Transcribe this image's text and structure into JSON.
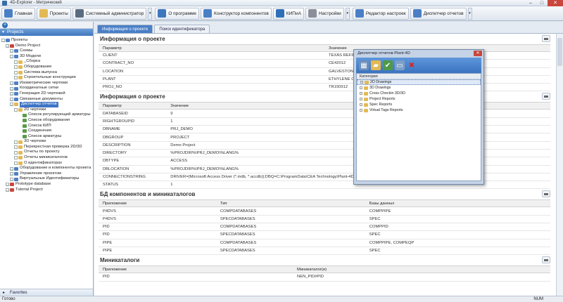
{
  "window": {
    "title": "4D-Explorer - Метрический"
  },
  "toolbar": [
    {
      "label": "Главная",
      "icon": "home-icon"
    },
    {
      "label": "Проекты",
      "icon": "projects-icon"
    },
    {
      "label": "Системный администратор",
      "icon": "admin-icon"
    },
    {
      "label": "О программе",
      "icon": "about-icon"
    },
    {
      "label": "Конструктор компонентов",
      "icon": "component-builder-icon"
    },
    {
      "label": "КИПиА",
      "icon": "instrumentation-icon"
    },
    {
      "label": "Настройки",
      "icon": "settings-icon"
    },
    {
      "label": "Редактор настроек",
      "icon": "settings-editor-icon"
    },
    {
      "label": "Диспетчер отчетов",
      "icon": "report-manager-icon"
    }
  ],
  "left_panel": {
    "header": "Projects",
    "favorites": "Favorites",
    "tree": [
      {
        "label": "Проекты",
        "level": 0,
        "icon": "blu"
      },
      {
        "label": "Demo Project",
        "level": 1,
        "icon": "red"
      },
      {
        "label": "Схемы",
        "level": 2,
        "icon": "blu"
      },
      {
        "label": "3D Модели",
        "level": 2,
        "icon": "blu"
      },
      {
        "label": "_Сборка",
        "level": 3,
        "icon": "yel"
      },
      {
        "label": "Оборудование",
        "level": 3,
        "icon": "yel"
      },
      {
        "label": "Система выпуска",
        "level": 3,
        "icon": "yel"
      },
      {
        "label": "Строительные конструкции",
        "level": 3,
        "icon": "yel"
      },
      {
        "label": "Изометрические чертежи",
        "level": 2,
        "icon": "blu"
      },
      {
        "label": "Координатные сетки",
        "level": 2,
        "icon": "blu"
      },
      {
        "label": "Генерация 2D чертежей",
        "level": 2,
        "icon": "blu"
      },
      {
        "label": "Связанные документы",
        "level": 2,
        "icon": "blu"
      },
      {
        "label": "Диспетчер отчетов",
        "level": 2,
        "icon": "yel",
        "selected": true
      },
      {
        "label": "2D чертежи",
        "level": 3,
        "icon": "yel"
      },
      {
        "label": "Список регулирующей арматуры",
        "level": 4,
        "icon": "grn"
      },
      {
        "label": "Список оборудования",
        "level": 4,
        "icon": "grn"
      },
      {
        "label": "Список КИП",
        "level": 4,
        "icon": "grn"
      },
      {
        "label": "Соединения",
        "level": 4,
        "icon": "grn"
      },
      {
        "label": "Список арматуры",
        "level": 4,
        "icon": "grn"
      },
      {
        "label": "3D чертежи",
        "level": 3,
        "icon": "yel"
      },
      {
        "label": "Перекрестная проверка 2D/3D",
        "level": 3,
        "icon": "yel"
      },
      {
        "label": "Отчеты по проекту",
        "level": 3,
        "icon": "yel"
      },
      {
        "label": "Отчеты миникаталогов",
        "level": 3,
        "icon": "yel"
      },
      {
        "label": "О идентификаторах",
        "level": 3,
        "icon": "yel"
      },
      {
        "label": "Оборудование и компоненты проекта",
        "level": 2,
        "icon": "blu"
      },
      {
        "label": "Управление проектом",
        "level": 2,
        "icon": "blu"
      },
      {
        "label": "Виртуальные Идентификаторы",
        "level": 2,
        "icon": "blu"
      },
      {
        "label": "Prototype database",
        "level": 1,
        "icon": "red"
      },
      {
        "label": "Tutorial Project",
        "level": 1,
        "icon": "red"
      }
    ]
  },
  "tabs": [
    {
      "label": "Информация о проекте",
      "active": true
    },
    {
      "label": "Поиск идентификатора",
      "active": false
    }
  ],
  "sections": [
    {
      "title": "Информация о проекте",
      "columns": [
        "Параметр",
        "Значение"
      ],
      "col_widths": [
        "50%",
        "50%"
      ],
      "rows": [
        [
          "CLIENT",
          "TEXAS REFINERY"
        ],
        [
          "CONTRACT_NO",
          "CE42012"
        ],
        [
          "LOCATION",
          "GALVESTON"
        ],
        [
          "PLANT",
          "ETHYLENE OXIDE"
        ],
        [
          "PROJ_NO",
          "TR150912"
        ]
      ]
    },
    {
      "title": "Информация о проекте",
      "columns": [
        "Параметр",
        "Значение"
      ],
      "col_widths": [
        "15%",
        "85%"
      ],
      "rows": [
        [
          "DATABASEID",
          "9"
        ],
        [
          "RIGHTGROUPID",
          "1"
        ],
        [
          "DBNAME",
          "PRJ_DEMO"
        ],
        [
          "DBGROUP",
          "PROJECT"
        ],
        [
          "DESCRIPTION",
          "Demo Project"
        ],
        [
          "DIRECTORY",
          "%PROJDIR%\\PRJ_DEMO\\%LANG%"
        ],
        [
          "DBTYPE",
          "ACCESS"
        ],
        [
          "DBLOCATION",
          "%PROJDIR%\\PRJ_DEMO\\%LANG%"
        ],
        [
          "CONNECTIONSTRING",
          "DRIVER={Microsoft Access Driver (*.mdb, *.accdb)};DBQ=C:\\ProgramData\\CEA Technology\\Plant-4D\\Projects\\METRIC\\PRJ_DEMO\\RU\\PRJ_DEMO.mdb;"
        ],
        [
          "STATUS",
          "1"
        ]
      ]
    },
    {
      "title": "БД компонентов и миникаталогов",
      "columns": [
        "Приложение",
        "Тип",
        "Базы данных"
      ],
      "col_widths": [
        "26%",
        "33%",
        "41%"
      ],
      "rows": [
        [
          "P4DVS",
          "COMPDATABASES",
          "COMPPIPE"
        ],
        [
          "P4DVS",
          "SPECDATABASES",
          "SPEC"
        ],
        [
          "PID",
          "COMPDATABASES",
          "COMPPID"
        ],
        [
          "PID",
          "SPECDATABASES",
          "SPEC"
        ],
        [
          "PIPE",
          "COMPDATABASES",
          "COMPPIPE, COMPEQP"
        ],
        [
          "PIPE",
          "SPECDATABASES",
          "SPEC"
        ]
      ]
    },
    {
      "title": "Миникаталоги",
      "columns": [
        "Приложение",
        "Миникаталог(и)"
      ],
      "col_widths": [
        "43%",
        "57%"
      ],
      "rows": [
        [
          "PID",
          "NEN_PID#PID"
        ]
      ]
    }
  ],
  "dialog": {
    "title": "Диспетчер отчетов Plant-4D",
    "close": "✕",
    "column": "Категория",
    "toolbar": [
      {
        "icon": "new-report-icon",
        "glyph": "▦",
        "color": "#6d8fb8"
      },
      {
        "icon": "open-folder-icon",
        "glyph": "▰",
        "color": "#e2b955"
      },
      {
        "icon": "check-icon",
        "glyph": "✔",
        "color": "#4f9a48"
      },
      {
        "icon": "blank-report-icon",
        "glyph": "▭",
        "color": "#7d9fc8"
      },
      {
        "icon": "delete-icon",
        "glyph": "✖",
        "color": "#cc2a2a"
      }
    ],
    "items": [
      {
        "label": "2D Drawings",
        "selected": true
      },
      {
        "label": "3D Drawings",
        "selected": false
      },
      {
        "label": "Cross Checkin 3D/3D",
        "selected": false
      },
      {
        "label": "Project Reports",
        "selected": false
      },
      {
        "label": "Spec Reports",
        "selected": false
      },
      {
        "label": "Virtual Tags Reports",
        "selected": false
      }
    ]
  },
  "statusbar": {
    "left": "Готово",
    "right": "NUM"
  },
  "colors": {
    "accent": "#4a7fc6",
    "header": "#3f77bd",
    "close": "#c9463d"
  }
}
